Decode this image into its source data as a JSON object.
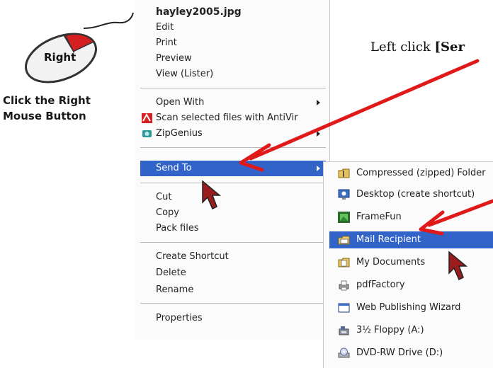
{
  "instruction": {
    "prefix": "Left click ",
    "emphasis": "[Ser"
  },
  "mouse": {
    "button_label": "Right",
    "caption_line1": "Click the Right",
    "caption_line2": "Mouse Button"
  },
  "context_menu": {
    "title": "hayley2005.jpg",
    "items": [
      {
        "label": "Edit"
      },
      {
        "label": "Print"
      },
      {
        "label": "Preview"
      },
      {
        "label": "View (Lister)"
      },
      {
        "label": "Open With"
      },
      {
        "label": "Scan selected files with AntiVir",
        "icon": "antivir-icon"
      },
      {
        "label": "ZipGenius",
        "icon": "zipgenius-icon"
      },
      {
        "label": "Send To",
        "highlighted": true
      },
      {
        "label": "Cut"
      },
      {
        "label": "Copy"
      },
      {
        "label": "Pack files"
      },
      {
        "label": "Create Shortcut"
      },
      {
        "label": "Delete"
      },
      {
        "label": "Rename"
      },
      {
        "label": "Properties"
      }
    ]
  },
  "submenu": {
    "items": [
      {
        "label": "Compressed (zipped) Folder",
        "icon": "zip-folder-icon"
      },
      {
        "label": "Desktop (create shortcut)",
        "icon": "desktop-icon"
      },
      {
        "label": "FrameFun",
        "icon": "framefun-icon"
      },
      {
        "label": "Mail Recipient",
        "icon": "mail-recipient-icon",
        "highlighted": true
      },
      {
        "label": "My Documents",
        "icon": "my-documents-icon"
      },
      {
        "label": "pdfFactory",
        "icon": "printer-icon"
      },
      {
        "label": "Web Publishing Wizard",
        "icon": "web-publishing-icon"
      },
      {
        "label": "3½ Floppy (A:)",
        "icon": "floppy-icon"
      },
      {
        "label": "DVD-RW Drive (D:)",
        "icon": "dvd-drive-icon"
      }
    ]
  },
  "colors": {
    "highlight": "#3163c8",
    "annotation_arrow": "#e01a1a",
    "cursor": "#8b1a1a"
  }
}
